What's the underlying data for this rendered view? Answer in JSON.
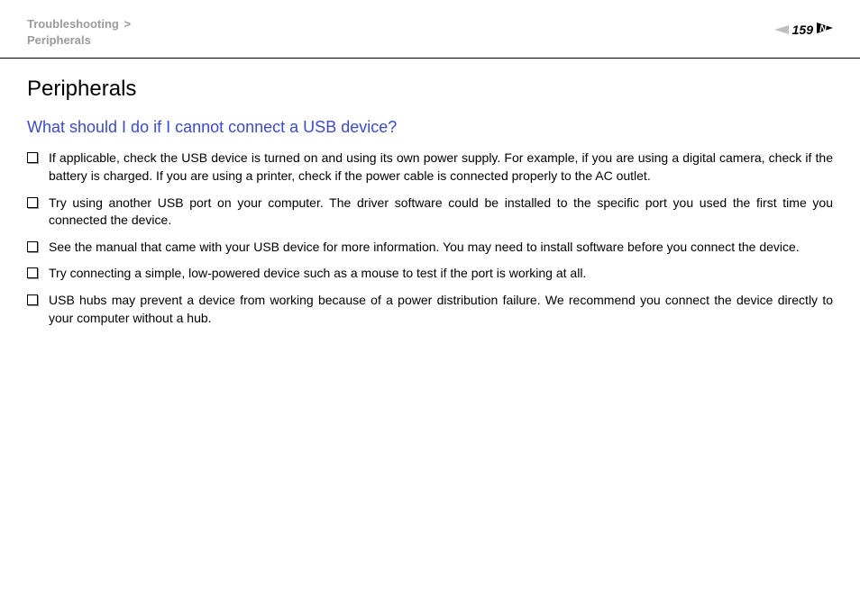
{
  "header": {
    "breadcrumb_parent": "Troubleshooting",
    "breadcrumb_separator": ">",
    "breadcrumb_current": "Peripherals",
    "page_number": "159"
  },
  "content": {
    "title": "Peripherals",
    "section_heading": "What should I do if I cannot connect a USB device?",
    "bullets": [
      "If applicable, check the USB device is turned on and using its own power supply. For example, if you are using a digital camera, check if the battery is charged. If you are using a printer, check if the power cable is connected properly to the AC outlet.",
      "Try using another USB port on your computer. The driver software could be installed to the specific port you used the first time you connected the device.",
      "See the manual that came with your USB device for more information. You may need to install software before you connect the device.",
      "Try connecting a simple, low-powered device such as a mouse to test if the port is working at all.",
      "USB hubs may prevent a device from working because of a power distribution failure. We recommend you connect the device directly to your computer without a hub."
    ]
  }
}
